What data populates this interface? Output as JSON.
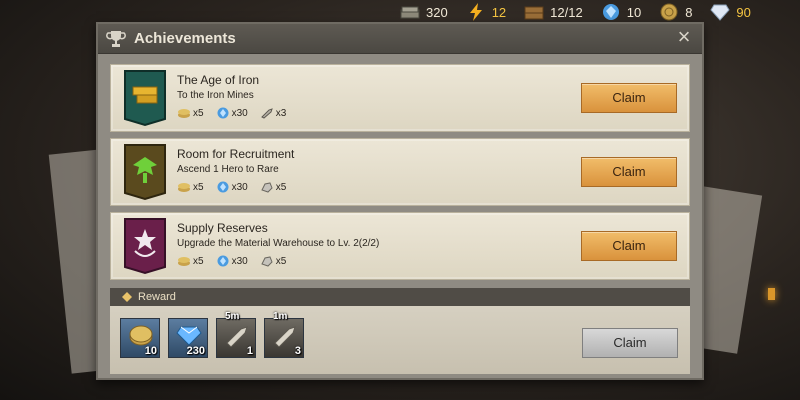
{
  "resources": [
    {
      "icon": "cash-stack-icon",
      "value": "320"
    },
    {
      "icon": "lightning-icon",
      "value": "12"
    },
    {
      "icon": "supply-crate-icon",
      "value": "12/12"
    },
    {
      "icon": "blue-gem-icon",
      "value": "10"
    },
    {
      "icon": "gold-coin-icon",
      "value": "8"
    },
    {
      "icon": "diamond-icon",
      "value": "90"
    }
  ],
  "panel": {
    "title": "Achievements",
    "close_icon": "×"
  },
  "achievements": [
    {
      "title": "The Age of Iron",
      "description": "To the Iron Mines",
      "badge_color": "#1f5a50",
      "rewards": [
        "x5",
        "x30",
        "x3"
      ],
      "claim_label": "Claim"
    },
    {
      "title": "Room for Recruitment",
      "description": "Ascend 1 Hero to Rare",
      "badge_color": "#5a4a1e",
      "rewards": [
        "x5",
        "x30",
        "x5"
      ],
      "claim_label": "Claim"
    },
    {
      "title": "Supply Reserves",
      "description": "Upgrade the Material Warehouse to Lv. 2(2/2)",
      "badge_color": "#6a1f4a",
      "rewards": [
        "x5",
        "x30",
        "x5"
      ],
      "claim_label": "Claim"
    }
  ],
  "reward_section": {
    "label": "Reward",
    "items": [
      {
        "icon": "gold-coin-icon",
        "count": "10"
      },
      {
        "icon": "blue-gem-icon",
        "count": "230"
      },
      {
        "icon": "speedup-5m-icon",
        "tag": "5m",
        "count": "1"
      },
      {
        "icon": "speedup-1m-icon",
        "tag": "1m",
        "count": "3"
      }
    ],
    "claim_label": "Claim"
  }
}
